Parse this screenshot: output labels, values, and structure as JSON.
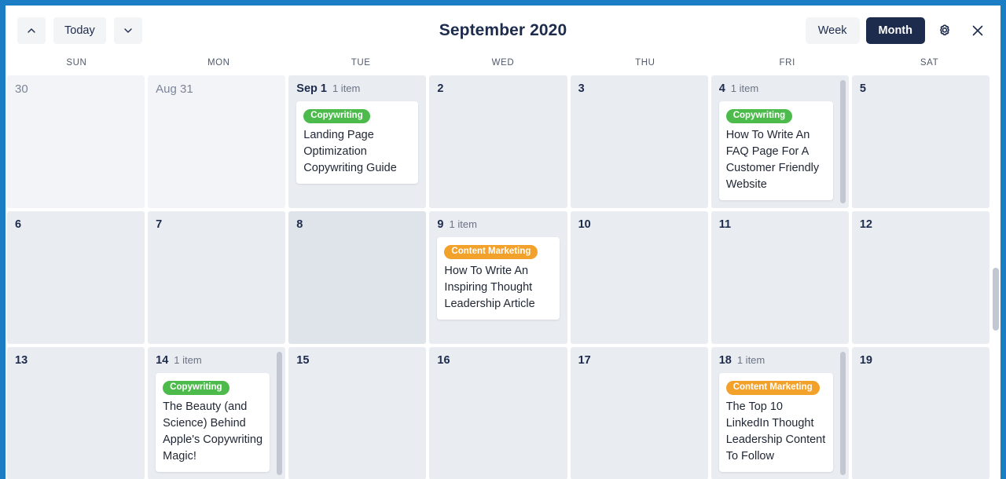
{
  "window": {
    "frame_color": "#1b7ec4"
  },
  "toolbar": {
    "prev_icon": "chevron-up-icon",
    "today_label": "Today",
    "next_icon": "chevron-down-icon",
    "title": "September 2020",
    "week_label": "Week",
    "month_label": "Month",
    "active_view": "Month",
    "settings_icon": "gear-icon",
    "close_icon": "close-icon"
  },
  "weekdays": [
    "SUN",
    "MON",
    "TUE",
    "WED",
    "THU",
    "FRI",
    "SAT"
  ],
  "colors": {
    "copywriting": "#4cbb4c",
    "content_marketing": "#f2a12a",
    "accent_dark": "#1d2b4c",
    "cell_bg": "#e9ecf1",
    "cell_outside_bg": "#f3f4f7",
    "cell_today_bg": "#dfe3ea"
  },
  "weeks": [
    {
      "days": [
        {
          "num": "30",
          "outside": true,
          "today": false,
          "count": "",
          "events": []
        },
        {
          "num": "Aug 31",
          "outside": true,
          "today": false,
          "count": "",
          "events": []
        },
        {
          "num": "Sep 1",
          "outside": false,
          "today": false,
          "count": "1 item",
          "scroll": false,
          "events": [
            {
              "category": "Copywriting",
              "color": "#4cbb4c",
              "title": "Landing Page Optimization Copywriting Guide"
            }
          ]
        },
        {
          "num": "2",
          "outside": false,
          "today": false,
          "count": "",
          "events": []
        },
        {
          "num": "3",
          "outside": false,
          "today": false,
          "count": "",
          "events": []
        },
        {
          "num": "4",
          "outside": false,
          "today": false,
          "count": "1 item",
          "scroll": true,
          "events": [
            {
              "category": "Copywriting",
              "color": "#4cbb4c",
              "title": "How To Write An FAQ Page For A Customer Friendly Website"
            }
          ]
        },
        {
          "num": "5",
          "outside": false,
          "today": false,
          "count": "",
          "events": []
        }
      ]
    },
    {
      "days": [
        {
          "num": "6",
          "outside": false,
          "today": false,
          "count": "",
          "events": []
        },
        {
          "num": "7",
          "outside": false,
          "today": false,
          "count": "",
          "events": []
        },
        {
          "num": "8",
          "outside": false,
          "today": true,
          "count": "",
          "events": []
        },
        {
          "num": "9",
          "outside": false,
          "today": false,
          "count": "1 item",
          "scroll": false,
          "events": [
            {
              "category": "Content Marketing",
              "color": "#f2a12a",
              "title": "How To Write An Inspiring Thought Leadership Article"
            }
          ]
        },
        {
          "num": "10",
          "outside": false,
          "today": false,
          "count": "",
          "events": []
        },
        {
          "num": "11",
          "outside": false,
          "today": false,
          "count": "",
          "events": []
        },
        {
          "num": "12",
          "outside": false,
          "today": false,
          "count": "",
          "events": []
        }
      ]
    },
    {
      "days": [
        {
          "num": "13",
          "outside": false,
          "today": false,
          "count": "",
          "events": []
        },
        {
          "num": "14",
          "outside": false,
          "today": false,
          "count": "1 item",
          "scroll": true,
          "events": [
            {
              "category": "Copywriting",
              "color": "#4cbb4c",
              "title": "The Beauty (and Science) Behind Apple's Copywriting Magic!"
            }
          ]
        },
        {
          "num": "15",
          "outside": false,
          "today": false,
          "count": "",
          "events": []
        },
        {
          "num": "16",
          "outside": false,
          "today": false,
          "count": "",
          "events": []
        },
        {
          "num": "17",
          "outside": false,
          "today": false,
          "count": "",
          "events": []
        },
        {
          "num": "18",
          "outside": false,
          "today": false,
          "count": "1 item",
          "scroll": true,
          "events": [
            {
              "category": "Content Marketing",
              "color": "#f2a12a",
              "title": "The Top 10 LinkedIn Thought Leadership Content To Follow"
            }
          ]
        },
        {
          "num": "19",
          "outside": false,
          "today": false,
          "count": "",
          "events": []
        }
      ]
    }
  ]
}
